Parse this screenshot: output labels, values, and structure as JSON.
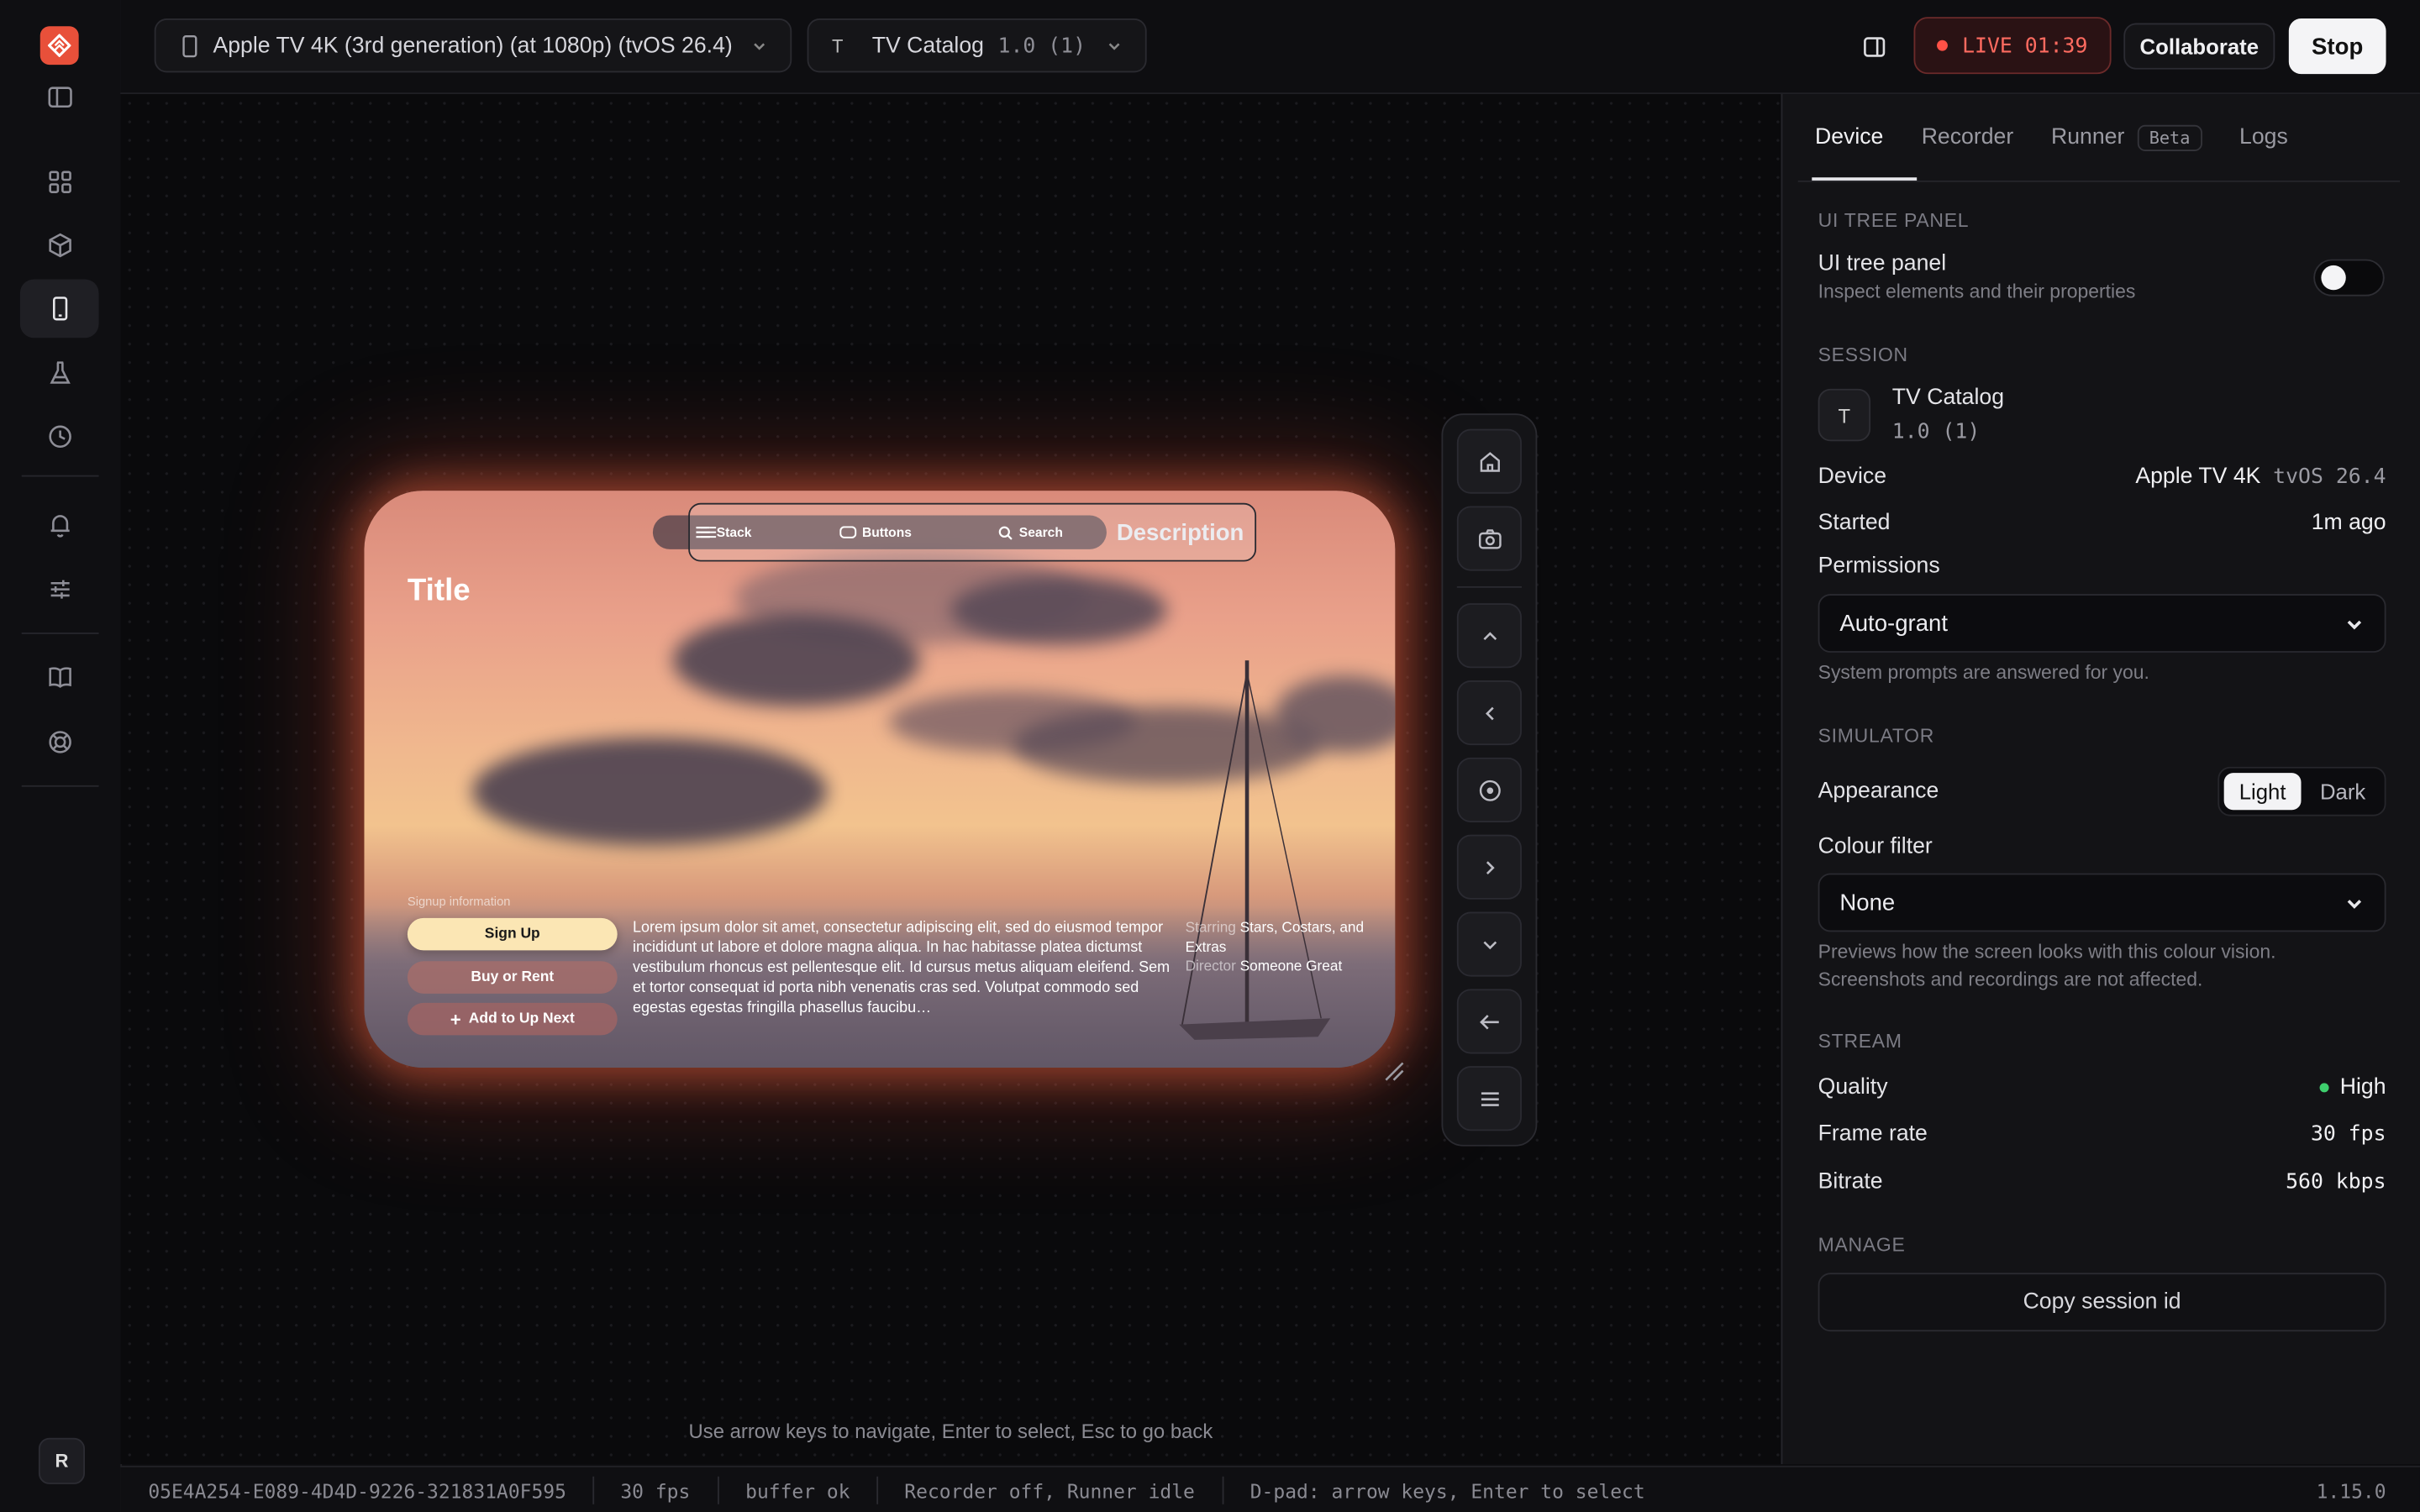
{
  "topbar": {
    "device_selector": "Apple TV 4K (3rd generation) (at 1080p) (tvOS 26.4)",
    "app_initial": "T",
    "app_name": "TV Catalog",
    "app_version": "1.0 (1)",
    "live_label": "LIVE 01:39",
    "collaborate_label": "Collaborate",
    "stop_label": "Stop"
  },
  "rail": {
    "avatar_initial": "R",
    "icons": [
      "apps-grid-icon",
      "package-icon",
      "device-icon",
      "flask-icon",
      "history-icon",
      "bell-icon",
      "sliders-icon",
      "book-icon",
      "lifebuoy-icon"
    ]
  },
  "tv": {
    "nav": [
      "Stack",
      "Buttons",
      "Description",
      "Search"
    ],
    "selected_nav": "Description",
    "title": "Title",
    "signup_label": "Signup information",
    "buttons": [
      "Sign Up",
      "Buy or Rent",
      "Add to Up Next"
    ],
    "description": "Lorem ipsum dolor sit amet, consectetur adipiscing elit, sed do eiusmod tempor incididunt ut labore et dolore magna aliqua. In hac habitasse platea dictumst vestibulum rhoncus est pellentesque elit. Id cursus metus aliquam eleifend. Sem et tortor consequat id porta nibh venenatis cras sed. Volutpat commodo sed egestas egestas fringilla phasellus faucibu…",
    "starring_label": "Starring",
    "starring": "Stars, Costars, and Extras",
    "director_label": "Director",
    "director": "Someone Great"
  },
  "canvas": {
    "hint": "Use arrow keys to navigate, Enter to select, Esc to go back"
  },
  "panel": {
    "tabs": [
      "Device",
      "Recorder",
      "Runner",
      "Logs"
    ],
    "runner_badge": "Beta",
    "ui_tree": {
      "section": "UI TREE PANEL",
      "label": "UI tree panel",
      "sublabel": "Inspect elements and their properties"
    },
    "session": {
      "section": "SESSION",
      "app_initial": "T",
      "app_name": "TV Catalog",
      "app_version": "1.0 (1)",
      "device_label": "Device",
      "device_name": "Apple TV 4K",
      "device_os": "tvOS 26.4",
      "started_label": "Started",
      "started_value": "1m ago",
      "permissions_label": "Permissions",
      "permissions_value": "Auto-grant",
      "permissions_note": "System prompts are answered for you."
    },
    "simulator": {
      "section": "SIMULATOR",
      "appearance_label": "Appearance",
      "appearance_light": "Light",
      "appearance_dark": "Dark",
      "colour_filter_label": "Colour filter",
      "colour_filter_value": "None",
      "colour_note_1": "Previews how the screen looks with this colour vision.",
      "colour_note_2": "Screenshots and recordings are not affected."
    },
    "stream": {
      "section": "STREAM",
      "quality_label": "Quality",
      "quality_value": "High",
      "quality_color": "#3ecf6e",
      "frame_rate_label": "Frame rate",
      "frame_rate_value": "30 fps",
      "bitrate_label": "Bitrate",
      "bitrate_value": "560 kbps"
    },
    "manage": {
      "section": "MANAGE",
      "copy_label": "Copy session id"
    }
  },
  "status": {
    "session_id": "05E4A254-E089-4D4D-9226-321831A0F595",
    "fps": "30 fps",
    "buffer": "buffer ok",
    "recorder": "Recorder off, Runner idle",
    "dpad": "D-pad: arrow keys, Enter to select",
    "version": "1.15.0"
  },
  "colors": {
    "accent": "#e8503a",
    "live_red": "#ff5147"
  }
}
